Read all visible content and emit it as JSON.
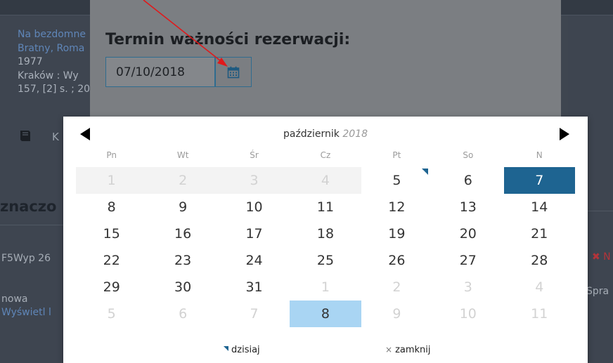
{
  "background": {
    "record": {
      "title": "Na bezdomne",
      "author": "Bratny, Roma",
      "year": "1977",
      "publisher": "Kraków : Wy",
      "extent": "157, [2] s. ; 20"
    },
    "book_label": "K",
    "section_heading": "znaczo",
    "row_code": "F5Wyp 26",
    "status_new": "nowa",
    "show_link": "Wyświetl l",
    "right_text": "Spra",
    "right_icon": "✖ N"
  },
  "modal": {
    "title": "Termin ważności rezerwacji:",
    "date_value": "07/10/2018",
    "calendar_button_icon": "calendar-icon"
  },
  "datepicker": {
    "month": "październik",
    "year": "2018",
    "prev_icon": "triangle-left-icon",
    "next_icon": "triangle-right-icon",
    "weekdays": [
      "Pn",
      "Wt",
      "Śr",
      "Cz",
      "Pt",
      "So",
      "N"
    ],
    "weeks": [
      [
        {
          "d": "1",
          "s": "disabled"
        },
        {
          "d": "2",
          "s": "disabled"
        },
        {
          "d": "3",
          "s": "disabled"
        },
        {
          "d": "4",
          "s": "disabled"
        },
        {
          "d": "5",
          "s": "today"
        },
        {
          "d": "6",
          "s": ""
        },
        {
          "d": "7",
          "s": "selected"
        }
      ],
      [
        {
          "d": "8",
          "s": ""
        },
        {
          "d": "9",
          "s": ""
        },
        {
          "d": "10",
          "s": ""
        },
        {
          "d": "11",
          "s": ""
        },
        {
          "d": "12",
          "s": ""
        },
        {
          "d": "13",
          "s": ""
        },
        {
          "d": "14",
          "s": ""
        }
      ],
      [
        {
          "d": "15",
          "s": ""
        },
        {
          "d": "16",
          "s": ""
        },
        {
          "d": "17",
          "s": ""
        },
        {
          "d": "18",
          "s": ""
        },
        {
          "d": "19",
          "s": ""
        },
        {
          "d": "20",
          "s": ""
        },
        {
          "d": "21",
          "s": ""
        }
      ],
      [
        {
          "d": "22",
          "s": ""
        },
        {
          "d": "23",
          "s": ""
        },
        {
          "d": "24",
          "s": ""
        },
        {
          "d": "25",
          "s": ""
        },
        {
          "d": "26",
          "s": ""
        },
        {
          "d": "27",
          "s": ""
        },
        {
          "d": "28",
          "s": ""
        }
      ],
      [
        {
          "d": "29",
          "s": ""
        },
        {
          "d": "30",
          "s": ""
        },
        {
          "d": "31",
          "s": ""
        },
        {
          "d": "1",
          "s": "outside"
        },
        {
          "d": "2",
          "s": "outside"
        },
        {
          "d": "3",
          "s": "outside"
        },
        {
          "d": "4",
          "s": "outside"
        }
      ],
      [
        {
          "d": "5",
          "s": "outside"
        },
        {
          "d": "6",
          "s": "outside"
        },
        {
          "d": "7",
          "s": "outside"
        },
        {
          "d": "8",
          "s": "highlight"
        },
        {
          "d": "9",
          "s": "outside"
        },
        {
          "d": "10",
          "s": "outside"
        },
        {
          "d": "11",
          "s": "outside"
        }
      ]
    ],
    "today_label": "dzisiaj",
    "close_label": "zamknij",
    "selected_color": "#1e6491",
    "highlight_color": "#a9d5f3"
  },
  "annotation": {
    "arrow_color": "#e0191b"
  }
}
